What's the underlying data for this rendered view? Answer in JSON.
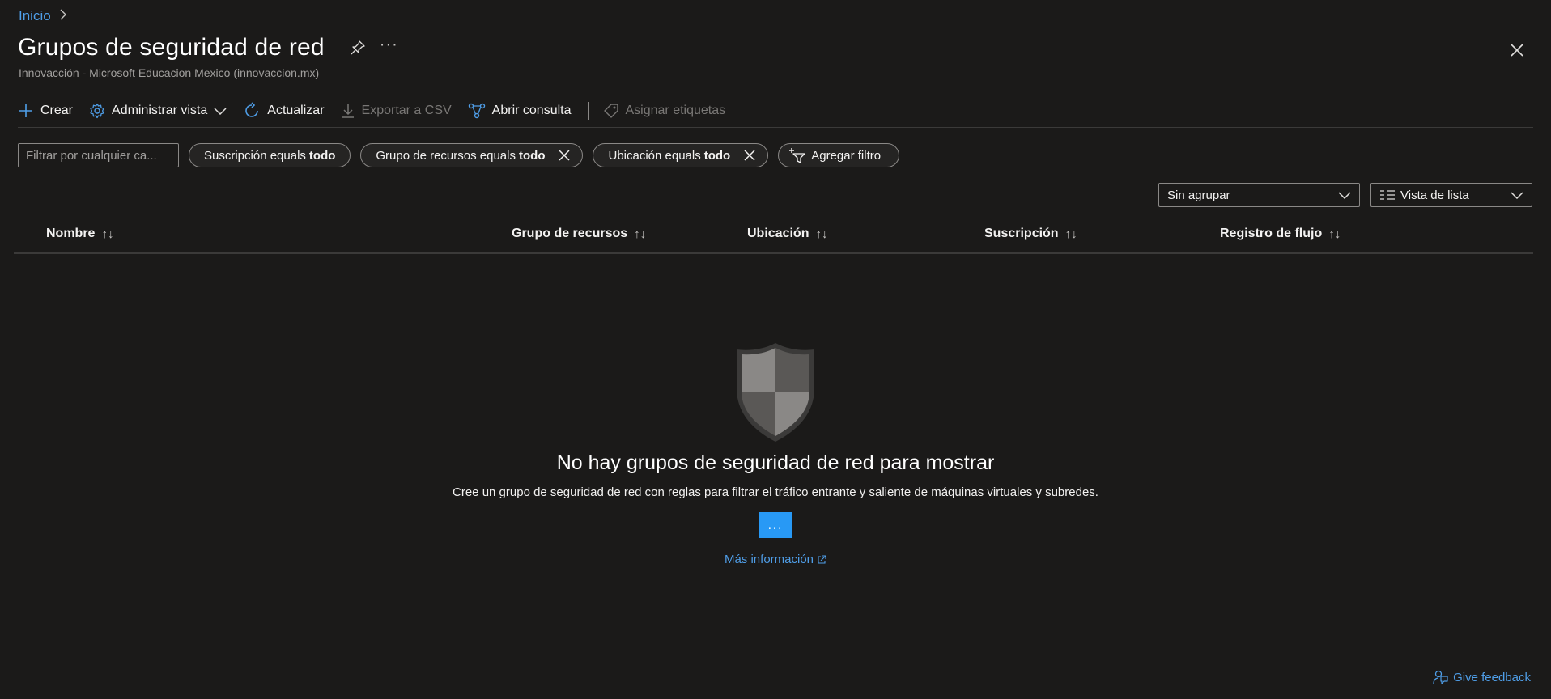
{
  "breadcrumb": {
    "home_label": "Inicio"
  },
  "header": {
    "title": "Grupos de seguridad de red",
    "subtitle": "Innovacción - Microsoft Educacion Mexico (innovaccion.mx)",
    "more_label": "···"
  },
  "toolbar": {
    "create_label": "Crear",
    "manage_view_label": "Administrar vista",
    "refresh_label": "Actualizar",
    "export_label": "Exportar a CSV",
    "open_query_label": "Abrir consulta",
    "assign_tags_label": "Asignar etiquetas"
  },
  "filters": {
    "search_placeholder": "Filtrar por cualquier ca...",
    "pills": [
      {
        "prefix": "Suscripción equals ",
        "value": "todo"
      },
      {
        "prefix": "Grupo de recursos equals ",
        "value": "todo"
      },
      {
        "prefix": "Ubicación equals ",
        "value": "todo"
      }
    ],
    "add_filter_label": "Agregar filtro"
  },
  "grouping": {
    "selected": "Sin agrupar"
  },
  "view": {
    "selected": "Vista de lista"
  },
  "table": {
    "columns": [
      "Nombre",
      "Grupo de recursos",
      "Ubicación",
      "Suscripción",
      "Registro de flujo"
    ],
    "sort_glyph": "↑↓"
  },
  "empty_state": {
    "title": "No hay grupos de seguridad de red para mostrar",
    "description": "Cree un grupo de seguridad de red con reglas para filtrar el tráfico entrante y saliente de máquinas virtuales y subredes.",
    "button_label": "...",
    "learn_more": "Más información"
  },
  "feedback": {
    "label": "Give feedback"
  },
  "colors": {
    "background": "#1b1a19",
    "accent": "#2899f5",
    "link": "#4f9ee8"
  }
}
